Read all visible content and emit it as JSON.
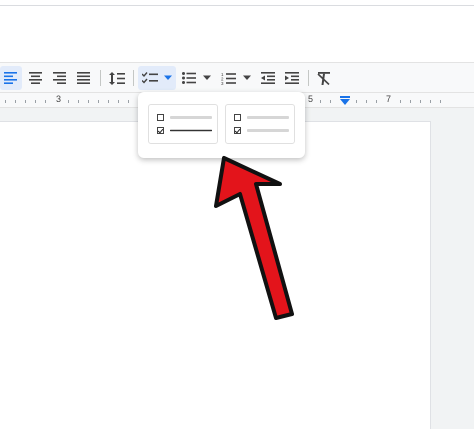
{
  "ruler": {
    "label_3": "3",
    "label_5": "5",
    "label_7": "7"
  },
  "toolbar": {
    "icons": [
      "align-left-icon",
      "align-center-icon",
      "align-right-icon",
      "justify-icon",
      "line-spacing-icon",
      "checklist-icon",
      "bulleted-list-icon",
      "numbered-list-icon",
      "decrease-indent-icon",
      "increase-indent-icon",
      "clear-formatting-icon"
    ]
  },
  "checklist_menu": {
    "options": [
      {
        "style": "checklist-strikethrough"
      },
      {
        "style": "checklist-plain"
      }
    ]
  },
  "colors": {
    "accent": "#1a73e8",
    "arrow_fill": "#e3141b",
    "toolbar_bg": "#f8f9fa"
  }
}
